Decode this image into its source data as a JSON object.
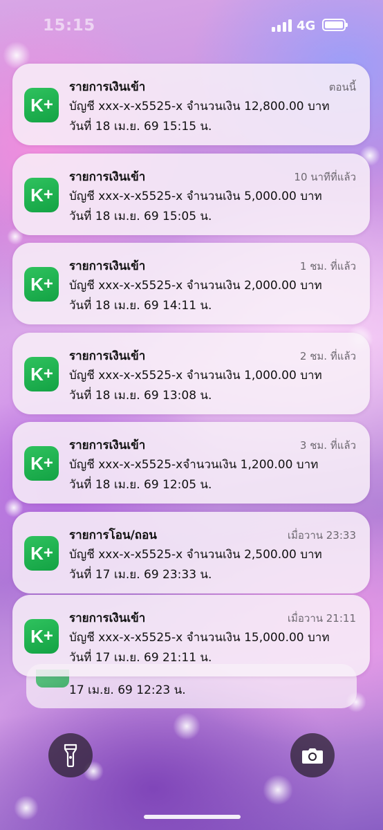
{
  "status_bar": {
    "time": "15:15",
    "network": "4G"
  },
  "notifications": [
    {
      "title": "รายการเงินเข้า",
      "time": "ตอนนี้",
      "line1": "บัญชี xxx-x-x5525-x จำนวนเงิน 12,800.00 บาท",
      "line2": "วันที่ 18 เม.ย. 69  15:15 น."
    },
    {
      "title": "รายการเงินเข้า",
      "time": "10 นาทีที่แล้ว",
      "line1": "บัญชี xxx-x-x5525-x จำนวนเงิน 5,000.00 บาท",
      "line2": "วันที่ 18 เม.ย. 69  15:05 น."
    },
    {
      "title": "รายการเงินเข้า",
      "time": "1 ชม. ที่แล้ว",
      "line1": "บัญชี xxx-x-x5525-x จำนวนเงิน 2,000.00 บาท",
      "line2": "วันที่ 18 เม.ย. 69  14:11 น."
    },
    {
      "title": "รายการเงินเข้า",
      "time": "2 ชม. ที่แล้ว",
      "line1": "บัญชี xxx-x-x5525-x จำนวนเงิน 1,000.00 บาท",
      "line2": "วันที่ 18 เม.ย. 69  13:08 น."
    },
    {
      "title": "รายการเงินเข้า",
      "time": "3 ชม. ที่แล้ว",
      "line1": "บัญชี xxx-x-x5525-xจำนวนเงิน 1,200.00 บาท",
      "line2": "วันที่ 18 เม.ย. 69  12:05 น."
    },
    {
      "title": "รายการโอน/ถอน",
      "time": "เมื่อวาน 23:33",
      "line1": "บัญชี xxx-x-x5525-x จำนวนเงิน 2,500.00 บาท",
      "line2": "วันที่ 17 เม.ย. 69  23:33 น."
    },
    {
      "title": "รายการเงินเข้า",
      "time": "เมื่อวาน 21:11",
      "line1": "บัญชี xxx-x-x5525-x จำนวนเงิน 15,000.00 บาท",
      "line2": "วันที่ 17 เม.ย. 69  21:11 น."
    }
  ],
  "app_icon": {
    "label": "K",
    "plus": "+",
    "name": "kplus-app-icon",
    "color": "#1aab4c"
  },
  "stacked": {
    "line": "17 เม.ย. 69  12:23 น."
  },
  "quick_actions": {
    "left": "flashlight-icon",
    "right": "camera-icon"
  }
}
